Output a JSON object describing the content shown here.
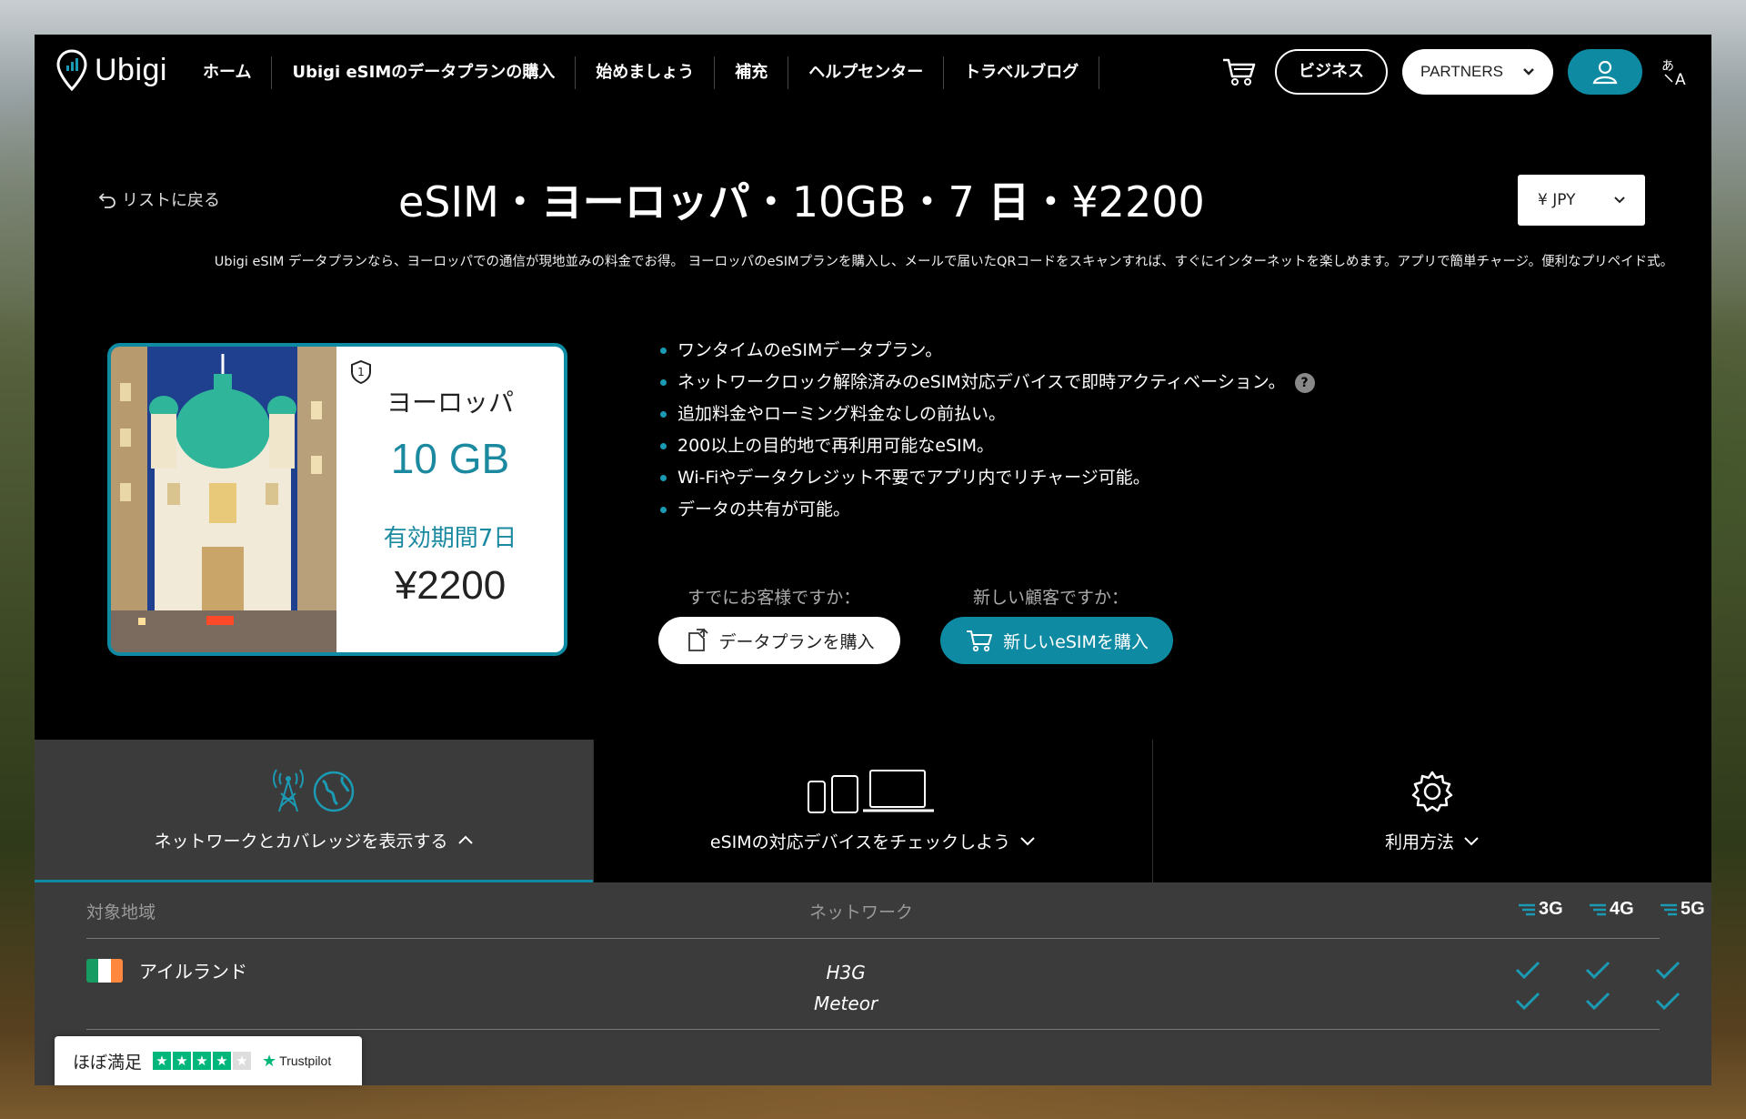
{
  "header": {
    "brand": "Ubigi",
    "nav": [
      "ホーム",
      "Ubigi eSIMのデータプランの購入",
      "始めましょう",
      "補充",
      "ヘルプセンター",
      "トラベルブログ"
    ],
    "business_label": "ビジネス",
    "partners_label": "PARTNERS",
    "lang_icon": "translate-icon"
  },
  "plan": {
    "back_label": "リストに戻る",
    "title_prefix": "eSIM・",
    "title_region": "ヨーロッパ",
    "title_mid": "・10GB・7",
    "title_day": "日",
    "title_price": "・¥2200",
    "currency": "¥ JPY",
    "intro": "Ubigi eSIM データプランなら、ヨーロッパでの通信が現地並みの料金でお得。 ヨーロッパのeSIMプランを購入し、メールで届いたQRコードをスキャンすれば、すぐにインターネットを楽しめます。アプリで簡単チャージ。便利なプリペイド式。"
  },
  "card": {
    "badge_number": "1",
    "region": "ヨーロッパ",
    "data": "10 GB",
    "validity": "有効期間7日",
    "price": "¥2200"
  },
  "features": [
    "ワンタイムのeSIMデータプラン。",
    "ネットワークロック解除済みのeSIM対応デバイスで即時アクティベーション。",
    "追加料金やローミング料金なしの前払い。",
    "200以上の目的地で再利用可能なeSIM。",
    "Wi-Fiやデータクレジット不要でアプリ内でリチャージ可能。",
    "データの共有が可能。"
  ],
  "help_glyph": "?",
  "cta": {
    "existing_label": "すでにお客様ですか：",
    "existing_button": "データプランを購入",
    "new_label": "新しい顧客ですか：",
    "new_button": "新しいeSIMを購入"
  },
  "tabs": [
    {
      "label": "ネットワークとカバレッジを表示する",
      "icon": "antenna-globe-icon",
      "active": true
    },
    {
      "label": "eSIMの対応デバイスをチェックしよう",
      "icon": "devices-icon",
      "active": false
    },
    {
      "label": "利用方法",
      "icon": "gear-icon",
      "active": false
    }
  ],
  "coverage": {
    "header_region": "対象地域",
    "header_network": "ネットワーク",
    "generations": [
      "3G",
      "4G",
      "5G"
    ],
    "rows": [
      {
        "country": "アイルランド",
        "networks": [
          "H3G",
          "Meteor"
        ],
        "flag": [
          "#169b62",
          "#ffffff",
          "#ff883e"
        ]
      }
    ]
  },
  "trustpilot": {
    "text": "ほぼ満足",
    "brand": "Trustpilot",
    "rating_stars": 4,
    "max_stars": 5
  },
  "colors": {
    "accent": "#0e8aa3",
    "check": "#1b9ab4"
  }
}
